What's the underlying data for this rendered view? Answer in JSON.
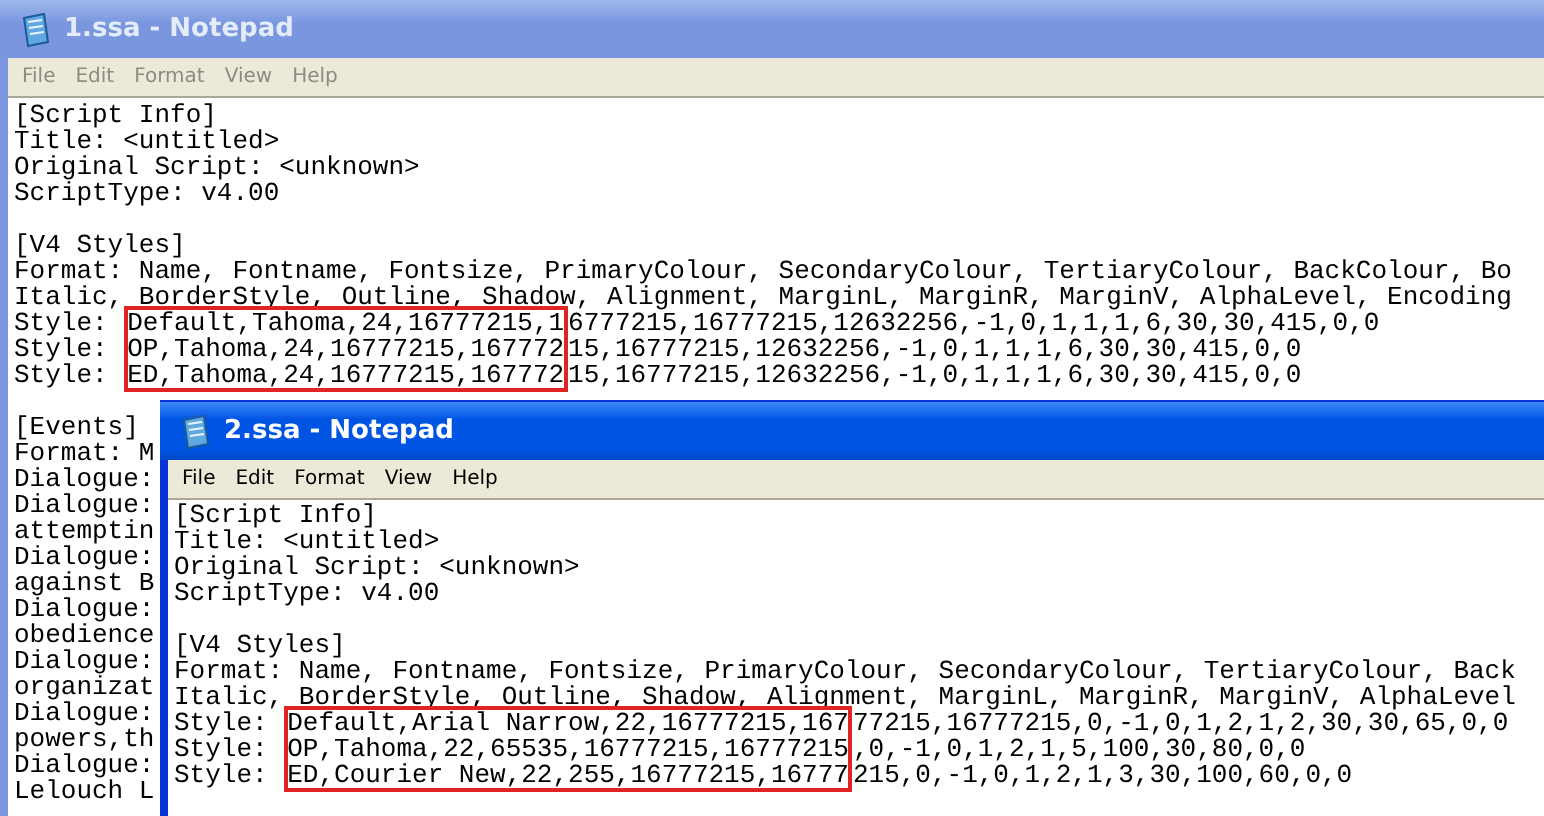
{
  "windows": [
    {
      "title": "1.ssa - Notepad",
      "active": false,
      "menu": [
        "File",
        "Edit",
        "Format",
        "View",
        "Help"
      ],
      "lines": [
        {
          "kind": "text",
          "text": "[Script Info]"
        },
        {
          "kind": "text",
          "text": "Title: <untitled>"
        },
        {
          "kind": "text",
          "text": "Original Script: <unknown>"
        },
        {
          "kind": "text",
          "text": "ScriptType: v4.00"
        },
        {
          "kind": "blank"
        },
        {
          "kind": "text",
          "text": "[V4 Styles]"
        },
        {
          "kind": "text",
          "text": "Format: Name, Fontname, Fontsize, PrimaryColour, SecondaryColour, TertiaryColour, BackColour, Bo"
        },
        {
          "kind": "text",
          "text": "Italic, BorderStyle, Outline, Shadow, Alignment, MarginL, MarginR, MarginV, AlphaLevel, Encoding"
        },
        {
          "kind": "styles",
          "rows": [
            {
              "key": "Style:",
              "boxed": "Default,Tahoma,24,16777215,1",
              "rest": "6777215,16777215,12632256,-1,0,1,1,1,6,30,30,415,0,0"
            },
            {
              "key": "Style:",
              "boxed": "OP,Tahoma,24,16777215,167772",
              "rest": "15,16777215,12632256,-1,0,1,1,1,6,30,30,415,0,0"
            },
            {
              "key": "Style:",
              "boxed": "ED,Tahoma,24,16777215,167772",
              "rest": "15,16777215,12632256,-1,0,1,1,1,6,30,30,415,0,0"
            }
          ]
        },
        {
          "kind": "blank"
        },
        {
          "kind": "text",
          "text": "[Events]"
        },
        {
          "kind": "text",
          "text": "Format: M"
        },
        {
          "kind": "text",
          "text": "Dialogue:"
        },
        {
          "kind": "text",
          "text": "Dialogue:"
        },
        {
          "kind": "text",
          "text": "attemptin"
        },
        {
          "kind": "text",
          "text": "Dialogue:"
        },
        {
          "kind": "text",
          "text": "against B"
        },
        {
          "kind": "text",
          "text": "Dialogue:"
        },
        {
          "kind": "text",
          "text": "obedience"
        },
        {
          "kind": "text",
          "text": "Dialogue:"
        },
        {
          "kind": "text",
          "text": "organizat"
        },
        {
          "kind": "text",
          "text": "Dialogue:"
        },
        {
          "kind": "text",
          "text": "powers,th"
        },
        {
          "kind": "text",
          "text": "Dialogue:"
        },
        {
          "kind": "text",
          "text": "Lelouch L"
        }
      ]
    },
    {
      "title": "2.ssa - Notepad",
      "active": true,
      "menu": [
        "File",
        "Edit",
        "Format",
        "View",
        "Help"
      ],
      "lines": [
        {
          "kind": "text",
          "text": "[Script Info]"
        },
        {
          "kind": "text",
          "text": "Title: <untitled>"
        },
        {
          "kind": "text",
          "text": "Original Script: <unknown>"
        },
        {
          "kind": "text",
          "text": "ScriptType: v4.00"
        },
        {
          "kind": "blank"
        },
        {
          "kind": "text",
          "text": "[V4 Styles]"
        },
        {
          "kind": "text",
          "text": "Format: Name, Fontname, Fontsize, PrimaryColour, SecondaryColour, TertiaryColour, Back"
        },
        {
          "kind": "text",
          "text": "Italic, BorderStyle, Outline, Shadow, Alignment, MarginL, MarginR, MarginV, AlphaLevel"
        },
        {
          "kind": "styles",
          "rows": [
            {
              "key": "Style:",
              "boxed": "Default,Arial Narrow,22,16777215,167",
              "rest": "77215,16777215,0,-1,0,1,2,1,2,30,30,65,0,0"
            },
            {
              "key": "Style:",
              "boxed": "OP,Tahoma,22,65535,16777215,16777215",
              "rest": ",0,-1,0,1,2,1,5,100,30,80,0,0"
            },
            {
              "key": "Style:",
              "boxed": "ED,Courier New,22,255,16777215,16777",
              "rest": "215,0,-1,0,1,2,1,3,30,100,60,0,0"
            }
          ]
        }
      ]
    }
  ]
}
